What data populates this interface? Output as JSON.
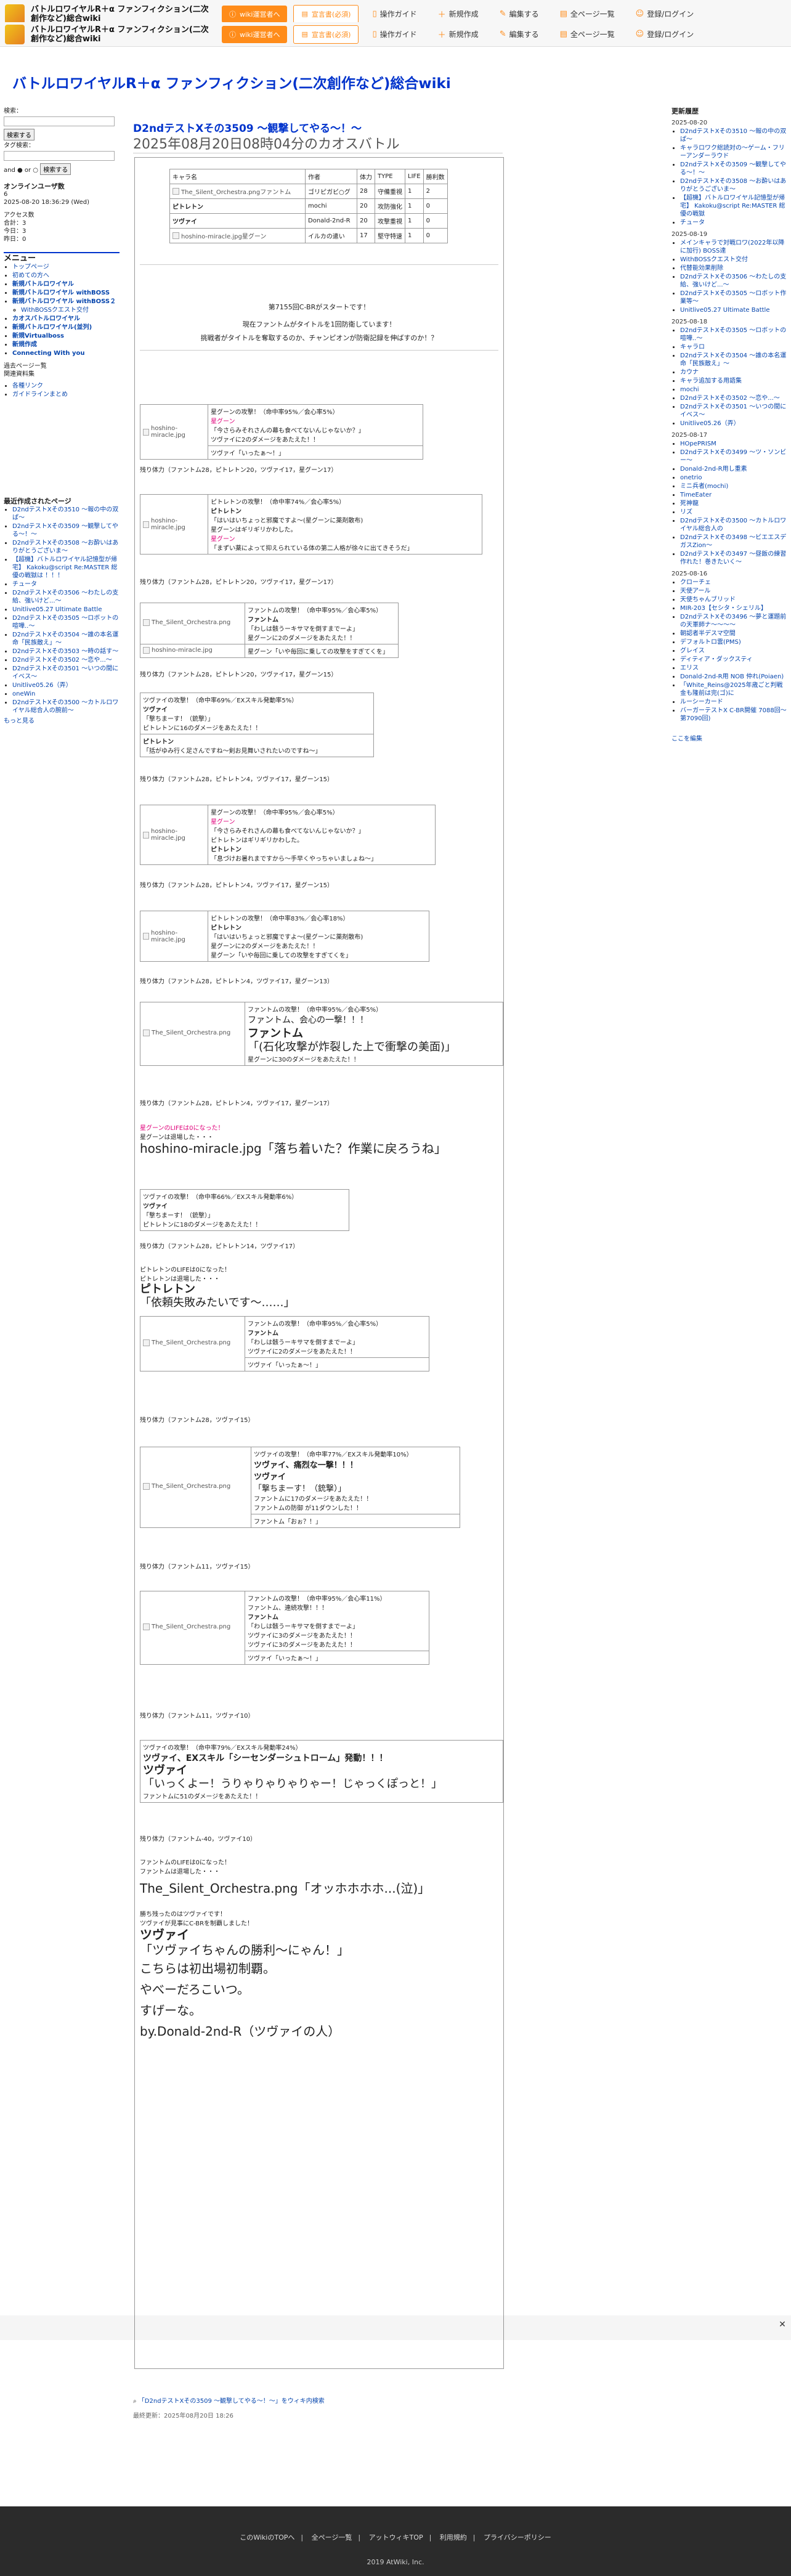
{
  "header": {
    "site_name": "バトルロワイヤルR＋α ファンフィクション(二次創作など)総合wiki",
    "info_btn": "wiki運営者へ",
    "ad_btn": "宣言書(必須)",
    "nav": [
      "操作ガイド",
      "新規作成",
      "編集する",
      "全ページ一覧",
      "登録/ログイン"
    ]
  },
  "wiki_title": "バトルロワイヤルR＋α ファンフィクション(二次創作など)総合wiki",
  "page": {
    "subtitle": "D2ndテストXその3509 〜観撃してやる〜！〜",
    "title": "2025年08月20日08時04分のカオスバトル"
  },
  "left": {
    "search_label1": "検索：",
    "search_btn1": "検索する",
    "search_label2": "タグ検索：",
    "and_or": "and ● or ○",
    "search_btn2": "検索する",
    "online_label": "オンラインユーザ数",
    "online_count": "6",
    "datetime": "2025-08-20 18:36:29 (Wed)",
    "counter_title": "アクセス数",
    "counter": [
      "合計：3",
      "今日：3",
      "昨日：0"
    ],
    "menu_title": "メニュー",
    "menu": [
      "トップページ",
      "初めての方へ",
      "新規バトルロワイヤル",
      "新規バトルロワイヤル withBOSS",
      "新規バトルロワイヤル withBOSS２",
      "WithBOSSクエスト交付",
      "カオスバトルロワイヤル",
      "新規バトルロワイヤル(並列)",
      "新規Virtualboss",
      "新規作成",
      "Connecting With you"
    ],
    "sub_menu": [
      "過去ページー覧",
      "関連資料集",
      "各種リンク",
      "ガイドラインまとめ"
    ],
    "recent_title": "最近作成されたページ",
    "recent": [
      "D2ndテストXその3510 〜報の中の双ぱ〜",
      "D2ndテストXその3509 〜観撃してやる〜！〜",
      "D2ndテストXその3508 〜お酔いはありがとうございま〜",
      "【超機】バトルロワイヤル記憶型が帰宅】 Kakoku@script Re:MASTER 総優の戦獄は ！！！",
      "チュータ",
      "D2ndテストXその3506 〜わたしの支給、強いけど...〜",
      "Unitlive05.27 Ultimate Battle",
      "D2ndテストXその3505 〜ロボットの喧嘩..〜",
      "D2ndテストXその3504 〜誰の本名運命「民族敵え」〜",
      "D2ndテストXその3503 〜時の話す〜",
      "D2ndテストXその3502 〜恋や...〜",
      "D2ndテストXその3501 〜いつの間にイベス〜",
      "Unitlive05.26（弄）",
      "oneWin",
      "D2ndテストXその3500 〜カトルロワイヤル総合人の腕前〜"
    ],
    "more": "もっと見る"
  },
  "ranking": {
    "headers": [
      "キャラ名",
      "作者",
      "体力",
      "TYPE",
      "LIFE",
      "勝利数"
    ],
    "rows": [
      [
        "The_Silent_Orchestra.pngファントム",
        "ゴリピガビ○グ",
        "28",
        "守備重視",
        "1",
        "2"
      ],
      [
        "ピトレトン",
        "mochi",
        "20",
        "攻防強化",
        "1",
        "0"
      ],
      [
        "ツヴァイ",
        "Donald-2nd-R",
        "20",
        "攻撃重視",
        "1",
        "0"
      ],
      [
        "hoshino-miracle.jpg星グーン",
        "イルカの遣い",
        "17",
        "堅守特速",
        "1",
        "0"
      ]
    ]
  },
  "intro": {
    "line1": "第7155回C-BRがスタートです！",
    "line2": "現在ファントムがタイトルを1回防衛しています！",
    "line3": "挑戦者がタイトルを奪取するのか、チャンピオンが防衛記録を伸ばすのか！？"
  },
  "turns": [
    {
      "hp": "残り体力（ファントム28，ピトレトン20，ツヴァイ17，星グーン17）"
    },
    {
      "hp": "残り体力（ファントム28，ピトレトン20，ツヴァイ17，星グーン17）"
    },
    {
      "hp": "残り体力（ファントム28，ピトレトン20，ツヴァイ17，星グーン15）"
    },
    {
      "hp": "残り体力（ファントム28，ピトレトン4，ツヴァイ17，星グーン15）"
    },
    {
      "hp": "残り体力（ファントム28，ピトレトン4，ツヴァイ17，星グーン15）"
    },
    {
      "hp": "残り体力（ファントム28，ピトレトン4，ツヴァイ17，星グーン13）"
    },
    {
      "hp": "残り体力（ファントム28，ピトレトン4，ツヴァイ17，星グーン17）"
    },
    {
      "hp": "残り体力（ファントム28，ピトレトン14，ツヴァイ17）"
    },
    {
      "hp": "残り体力（ファントム28，ツヴァイ15）"
    },
    {
      "hp": "残り体力（ファントム11，ツヴァイ15）"
    },
    {
      "hp": "残り体力（ファントム11，ツヴァイ10）"
    },
    {
      "hp": "残り体力（ファントム-40，ツヴァイ10）"
    }
  ],
  "battle": {
    "b1": [
      "星グーンの攻撃！（命中率95%／会心率5%）",
      "星グーン",
      "「今さらみそれさんの幕も食べてないんじゃないか？」",
      "ツヴァイに2のダメージをあたえた！！"
    ],
    "b1r": "ツヴァイ「いったぁ〜！」",
    "b2": [
      "ピトレトンの攻撃！（命中率74%／会心率5%）",
      "ピトレトン",
      "「はいはいちょっと邪魔ですよ～(星グーンに薬剤散布)",
      "星グーンはギリギリかわした。",
      "星グーン",
      "「まずい薬によって抑えられている体の第二人格が徐々に出てきそうだ」"
    ],
    "b3": [
      "ファントムの攻撃！（命中率95%／会心率5%）",
      "ファントム",
      "「わしは骸うーキサマを倒すまでーよ」",
      "星グーンに2のダメージをあたえた！！",
      "星グーン「いや毎回に乗しての攻撃をすぎてくを」"
    ],
    "b4": [
      "ツヴァイの攻撃！（命中率69%／EXスキル発動率5%）",
      "ツヴァイ",
      "「撃ちまーす！（銃撃）」",
      "ピトレトンに16のダメージをあたえた！！",
      "ピトレトン",
      "「括がゆみ行く足さんですね〜剣お見舞いされたいのですね〜」"
    ],
    "b5": [
      "星グーンの攻撃！（命中率95%／会心率5%）",
      "星グーン",
      "「今さらみそれさんの幕も食べてないんじゃないか？」",
      "ピトレトンはギリギリかわした。",
      "ピトレトン",
      "「息づけお暑れまですから〜手早くやっちゃいましょね〜」"
    ],
    "b6": [
      "ピトレトンの攻撃！（命中率83%／会心率18%）",
      "ピトレトン",
      "「はいはいちょっと邪魔ですよ～(星グーンに薬剤散布)",
      "星グーンに2のダメージをあたえた！！",
      "星グーン「いや毎回に乗しての攻撃をすぎてくを」"
    ],
    "b7": [
      "ファントムの攻撃！（命中率95%／会心率5%）",
      "ファントム、会心の一撃！！！",
      "ファントム",
      "「(石化攻撃が炸裂した上で衝撃の美面)」",
      "星グーンに30のダメージをあたえた！！"
    ],
    "b8": [
      "星グーンのLIFEは0になった！",
      "星グーンは退場した・・・",
      "hoshino-miracle.jpg「落ち着いた？作業に戻ろうね」"
    ],
    "b9": [
      "ツヴァイの攻撃！（命中率66%／EXスキル発動率6%）",
      "ツヴァイ",
      "「撃ちまーす！（銃撃）」",
      "ピトレトンに18のダメージをあたえた！！"
    ],
    "b10": [
      "ピトレトンのLIFEは0になった！",
      "ピトレトンは退場した・・・",
      "ピトレトン",
      "「依頼失敗みたいです〜……」"
    ],
    "b11": [
      "ファントムの攻撃！（命中率95%／会心率5%）",
      "ファントム",
      "「わしは骸うーキサマを倒すまでーよ」",
      "ツヴァイに2のダメージをあたえた！！",
      "ツヴァイ「いったぁ〜！」"
    ],
    "b12": [
      "ツヴァイの攻撃！（命中率77%／EXスキル発動率10%）",
      "ツヴァイ、痛烈な一撃！！！",
      "ツヴァイ",
      "「撃ちまーす！（銃撃）」",
      "ファントムに17のダメージをあたえた！！",
      "ファントムの防御 が11ダウンした！！",
      "ファントム「おぉ？！」"
    ],
    "b13": [
      "ファントムの攻撃！（命中率95%／会心率11%）",
      "ファントム、連続攻撃！！！",
      "ファントム",
      "「わしは骸うーキサマを倒すまでーよ」",
      "ツヴァイに3のダメージをあたえた！！",
      "ツヴァイに3のダメージをあたえた！！",
      "ツヴァイ「いったぁ〜！」"
    ],
    "b14": [
      "ツヴァイの攻撃！（命中率79%／EXスキル発動率24%）",
      "ツヴァイ、EXスキル「シーセンダーシュトローム」発動！！！",
      "ツヴァイ",
      "「いっくよー！うりゃりゃりゃりゃー！じゃっくぽっと！」",
      "ファントムに51のダメージをあたえた！！"
    ],
    "b15": [
      "ファントムのLIFEは0になった！",
      "ファントムは退場した・・・",
      "The_Silent_Orchestra.png「オッホホホホ...(泣)」",
      "勝ち残ったのはツヴァイです！",
      "ツヴァイが見事にC-BRを制覇しました！",
      "ツヴァイ",
      "「ツヴァイちゃんの勝利〜にゃん！」",
      "こちらは初出場初制覇。",
      "やべーだろこいつ。",
      "すげーな。",
      "by.Donald-2nd-R（ツヴァイの人）"
    ]
  },
  "bottom": {
    "share": "「D2ndテストXその3509 〜観撃してやる〜！〜」をウィキ内検索",
    "updated": "最終更新：2025年08月20日 18:26"
  },
  "right": {
    "title": "更新履歴",
    "groups": [
      {
        "date": "2025-08-20",
        "items": [
          "D2ndテストXその3510 〜報の中の双ぱ〜",
          "キャラロワク総読対の〜ゲーム・フリーアンダーラウド",
          "D2ndテストXその3509 〜観撃してやる〜！〜",
          "D2ndテストXその3508 〜お酔いはありがとうございま〜",
          "【超機】バトルロワイヤル記憶型が帰宅】 Kakoku@script Re:MASTER 総優の戦獄",
          "チュータ"
        ]
      },
      {
        "date": "2025-08-19",
        "items": [
          "メインキャラで対戦ロワ(2022年以降に加行) BOSS達",
          "WithBOSSクエスト交付",
          "代替能効果削除",
          "D2ndテストXその3506 〜わたしの支給、強いけど...〜",
          "D2ndテストXその3505 〜ロボット作業等〜",
          "Unitlive05.27 Ultimate Battle"
        ]
      },
      {
        "date": "2025-08-18",
        "items": [
          "D2ndテストXその3505 〜ロボットの喧嘩..〜",
          "キャラロ",
          "D2ndテストXその3504 〜誰の本名運命「民族敵え」〜",
          "カウナ",
          "キャラ追加する用語集",
          "mochi",
          "D2ndテストXその3502 〜恋や...〜",
          "D2ndテストXその3501 〜いつの間にイベス〜",
          "Unitlive05.26（弄）"
        ]
      },
      {
        "date": "2025-08-17",
        "items": [
          "HOpePRISM",
          "D2ndテストXその3499 〜ツ・ソンビー〜",
          "Donald-2nd-R用し重素",
          "onetrio",
          "ミニ兵者(mochi)",
          "TimeEater",
          "死神龍",
          "リズ",
          "D2ndテストXその3500 〜カトルロワイヤル総合人の",
          "D2ndテストXその3498 〜ビエエスデガスZion〜",
          "D2ndテストXその3497 〜昼飯の練習作れた！巻きたいく〜"
        ]
      },
      {
        "date": "2025-08-16",
        "items": [
          "クローチェ",
          "天使アール",
          "天使ちゃんブリッド",
          "MIR-203【セシタ・シェリル】",
          "D2ndテストXその3496 〜夢と運題前の天軍師ナ〜〜〜〜",
          "朝認者半デスマ空間",
          "デフォルトロ雲(PMS)",
          "グレイス",
          "ディティア・ダックスティ",
          "エリス",
          "Donald-2nd-R用 NOB 仲れ(Poiaen)",
          "「White_Reins@2025年歳ごと判戦金も隆前は完(ゴ)に ",
          "ルーシーカード",
          "バーガーテストX C-BR開催 7088回〜第7090回)"
        ]
      }
    ],
    "edit": "ここを編集"
  },
  "footer": {
    "links": [
      "このWikiのTOPへ",
      "全ページ一覧",
      "アットウィキTOP",
      "利用規約",
      "プライバシーポリシー"
    ],
    "copyright": "2019 AtWiki, Inc."
  }
}
